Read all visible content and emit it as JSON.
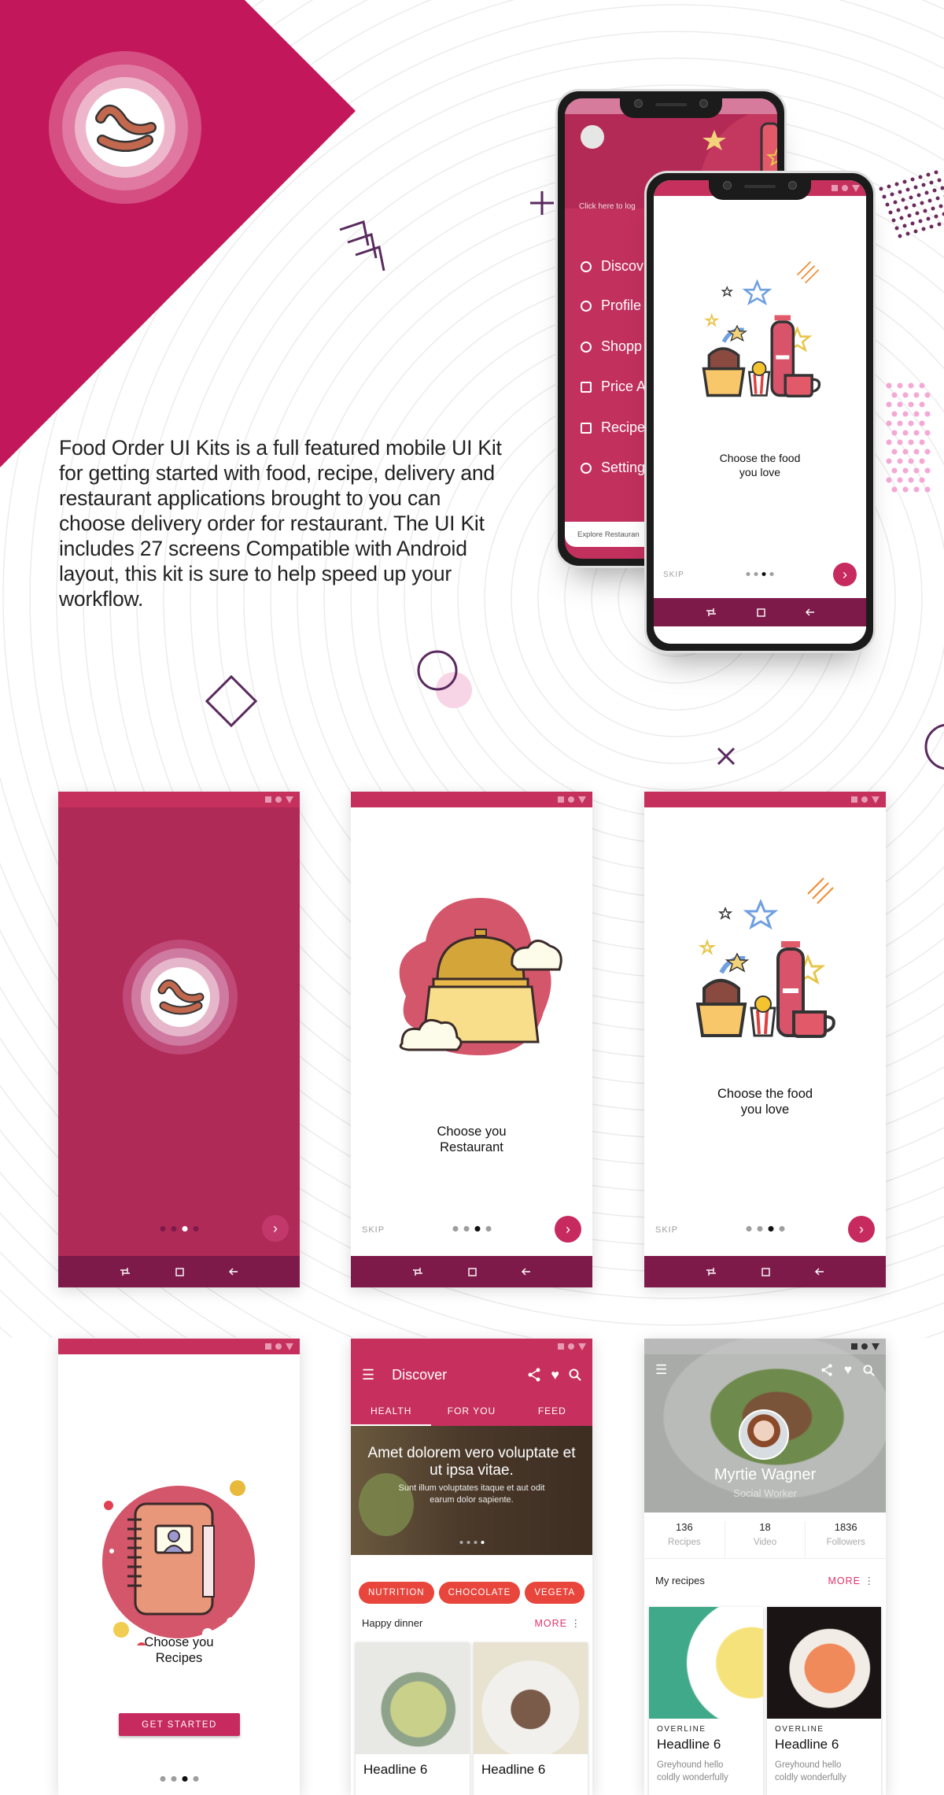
{
  "colors": {
    "brand": "#c2185b",
    "status_bar": "#c5305c",
    "splash_bg": "#b02a58",
    "nav_bar": "#7d1a4a",
    "chip": "#e8453c",
    "accent_text": "#e0336a"
  },
  "intro": {
    "text": "Food Order UI Kits is a full featured mobile UI Kit for getting started with food, recipe, delivery and restaurant applications brought to you can choose delivery order for restaurant. The UI Kit includes 27 screens Compatible with Android layout, this kit is sure to help speed up your workflow."
  },
  "drawer_phone": {
    "login_prompt": "Click here to log",
    "menu": [
      {
        "icon": "compass-icon",
        "label": "Discov"
      },
      {
        "icon": "profile-icon",
        "label": "Profile"
      },
      {
        "icon": "cart-icon",
        "label": "Shopp"
      },
      {
        "icon": "price-icon",
        "label": "Price A"
      },
      {
        "icon": "recipe-icon",
        "label": "Recipe"
      },
      {
        "icon": "settings-icon",
        "label": "Setting"
      }
    ],
    "footer": "Explore Restauran"
  },
  "onboarding_food": {
    "caption_line1": "Choose the food",
    "caption_line2": "you love",
    "skip": "SKIP",
    "next_icon": "chevron-right-icon",
    "page": 3,
    "pages": 4
  },
  "splash": {
    "page": 3,
    "pages": 4,
    "next_icon": "chevron-right-icon"
  },
  "onboarding_restaurant": {
    "caption_line1": "Choose you",
    "caption_line2": "Restaurant",
    "skip": "SKIP",
    "page": 3,
    "pages": 4
  },
  "onboarding_recipes": {
    "caption_line1": "Choose you",
    "caption_line2": "Recipes",
    "button": "GET STARTED",
    "page": 3,
    "pages": 4
  },
  "discover": {
    "title": "Discover",
    "tabs": [
      "HEALTH",
      "FOR YOU",
      "FEED"
    ],
    "active_tab": "HEALTH",
    "hero_title": "Amet dolorem vero voluptate et ut ipsa vitae.",
    "hero_sub": "Sunt illum voluptates itaque et aut odit earum dolor sapiente.",
    "chips": [
      "NUTRITION",
      "CHOCOLATE",
      "VEGETA"
    ],
    "section": "Happy dinner",
    "more": "MORE",
    "cards": [
      {
        "headline": "Headline 6"
      },
      {
        "headline": "Headline 6"
      }
    ]
  },
  "profile": {
    "name": "Myrtie Wagner",
    "role": "Social Worker",
    "stats": [
      {
        "value": "136",
        "label": "Recipes"
      },
      {
        "value": "18",
        "label": "Video"
      },
      {
        "value": "1836",
        "label": "Followers"
      }
    ],
    "section": "My recipes",
    "more": "MORE",
    "cards": [
      {
        "overline": "OVERLINE",
        "headline": "Headline 6",
        "desc1": "Greyhound hello",
        "desc2": "coldly wonderfully"
      },
      {
        "overline": "OVERLINE",
        "headline": "Headline 6",
        "desc1": "Greyhound hello",
        "desc2": "coldly wonderfully"
      }
    ]
  }
}
